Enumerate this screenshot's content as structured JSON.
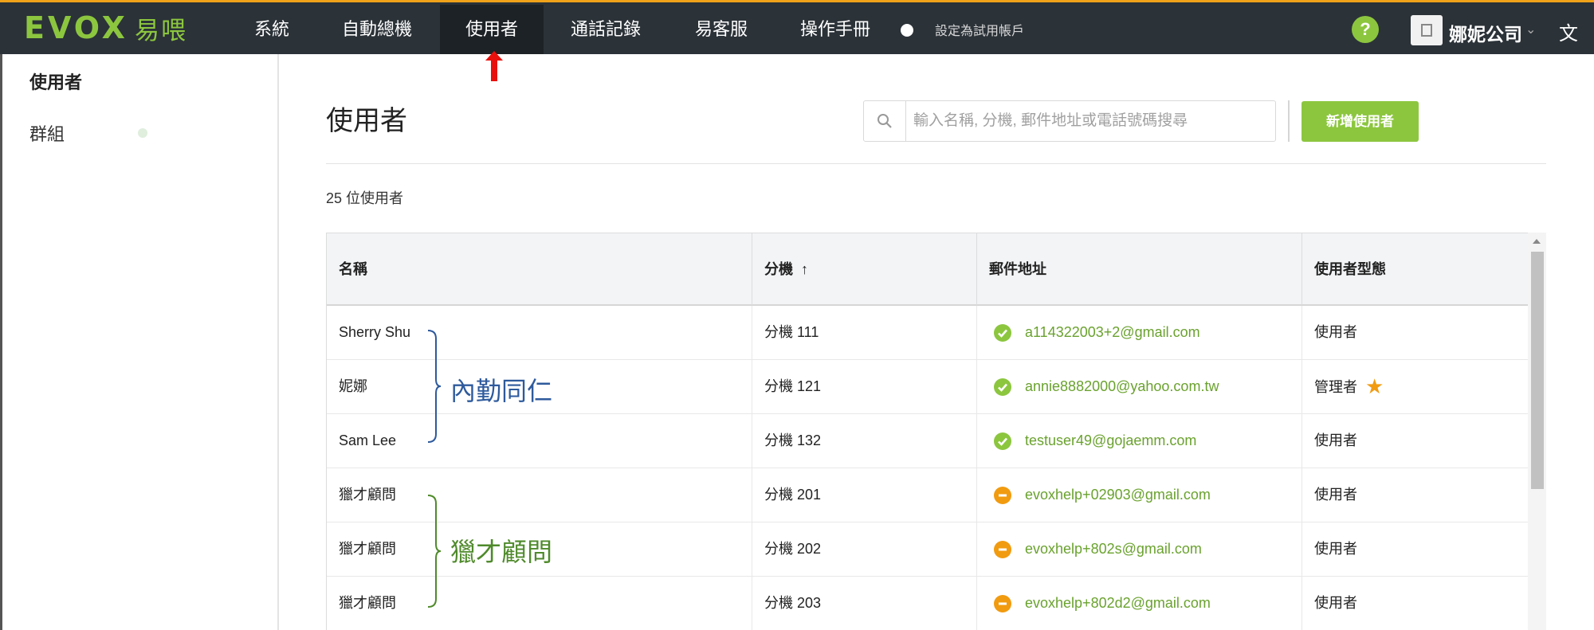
{
  "brand": {
    "logo_text": "EVOX",
    "logo_cn": "易喂"
  },
  "nav": {
    "items": [
      {
        "label": "系統"
      },
      {
        "label": "自動總機"
      },
      {
        "label": "使用者"
      },
      {
        "label": "通話記錄"
      },
      {
        "label": "易客服"
      },
      {
        "label": "操作手冊"
      }
    ],
    "active": "使用者",
    "trial_label": "設定為試用帳戶",
    "help_label": "?",
    "company": "娜妮公司"
  },
  "colors": {
    "accent": "#8cc63f",
    "topbar": "#2b3238",
    "pending": "#f19b10",
    "annotation_blue": "#2e5a9c",
    "annotation_green": "#4f8a2b",
    "arrow": "#e8100c"
  },
  "sidebar": {
    "items": [
      {
        "label": "使用者"
      },
      {
        "label": "群組"
      }
    ]
  },
  "main": {
    "title": "使用者",
    "search_placeholder": "輸入名稱, 分機, 郵件地址或電話號碼搜尋",
    "add_button": "新增使用者",
    "count_label": "25 位使用者"
  },
  "table": {
    "headers": {
      "name": "名稱",
      "ext": "分機",
      "email": "郵件地址",
      "type": "使用者型態"
    },
    "sort": {
      "column": "分機",
      "direction": "ascending"
    },
    "rows": [
      {
        "name": "Sherry Shu",
        "ext": "分機 111",
        "email": "a114322003+2@gmail.com",
        "status": "verified",
        "type": "使用者",
        "admin": false
      },
      {
        "name": "妮娜",
        "ext": "分機 121",
        "email": "annie8882000@yahoo.com.tw",
        "status": "verified",
        "type": "管理者",
        "admin": true
      },
      {
        "name": "Sam Lee",
        "ext": "分機 132",
        "email": "testuser49@gojaemm.com",
        "status": "verified",
        "type": "使用者",
        "admin": false
      },
      {
        "name": "獵才顧問",
        "ext": "分機 201",
        "email": "evoxhelp+02903@gmail.com",
        "status": "pending",
        "type": "使用者",
        "admin": false
      },
      {
        "name": "獵才顧問",
        "ext": "分機 202",
        "email": "evoxhelp+802s@gmail.com",
        "status": "pending",
        "type": "使用者",
        "admin": false
      },
      {
        "name": "獵才顧問",
        "ext": "分機 203",
        "email": "evoxhelp+802d2@gmail.com",
        "status": "pending",
        "type": "使用者",
        "admin": false
      }
    ]
  },
  "annotations": [
    {
      "text": "內勤同仁"
    },
    {
      "text": "獵才顧問"
    }
  ]
}
